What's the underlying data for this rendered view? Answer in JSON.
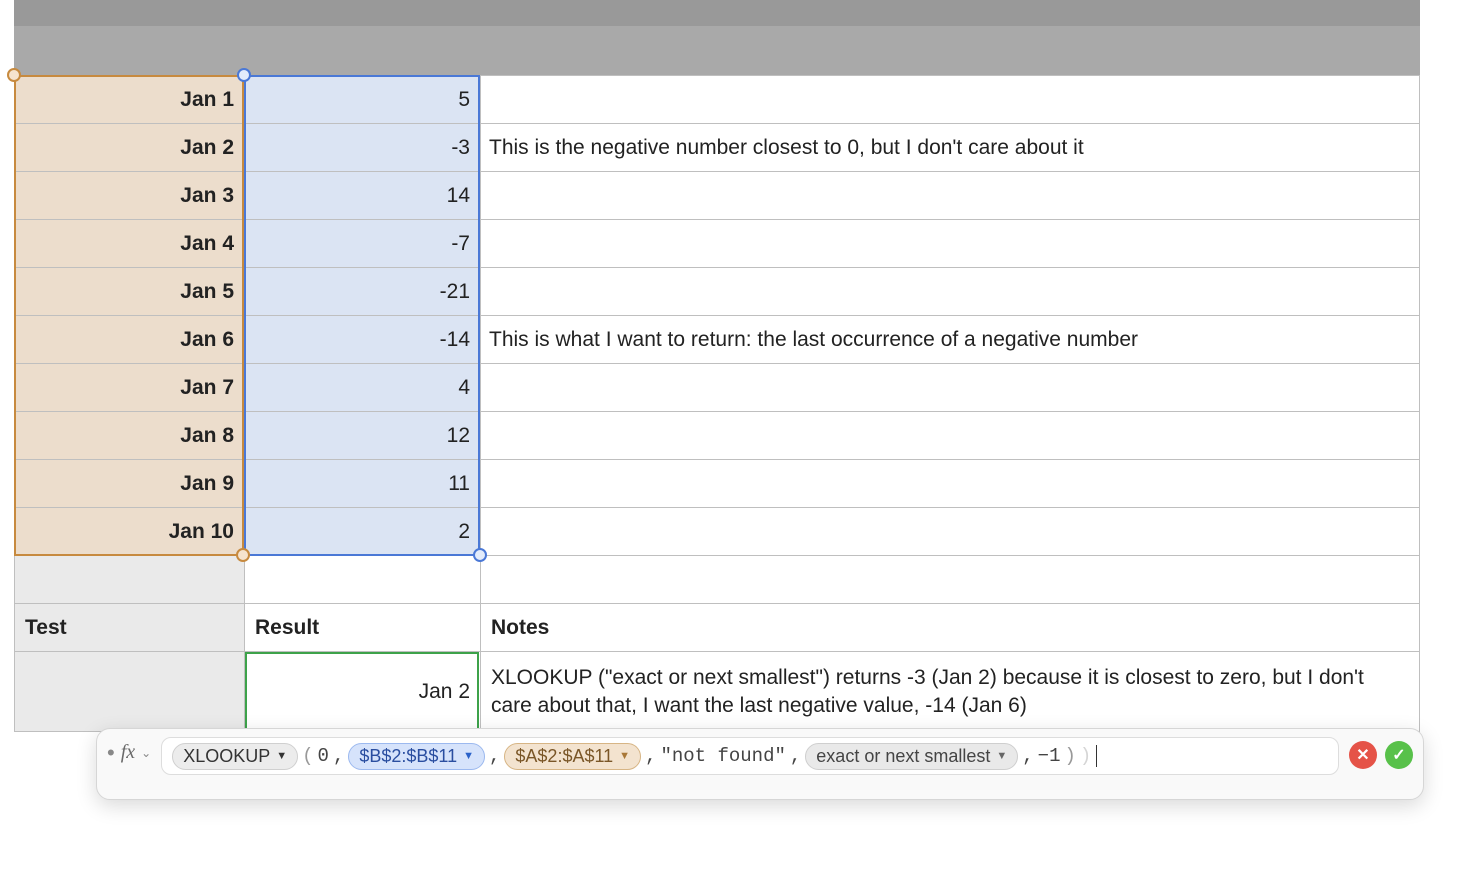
{
  "table": {
    "rows": [
      {
        "date": "Jan 1",
        "value": "5",
        "note": ""
      },
      {
        "date": "Jan 2",
        "value": "-3",
        "note": "This is the negative number closest to 0, but I don't care about it"
      },
      {
        "date": "Jan 3",
        "value": "14",
        "note": ""
      },
      {
        "date": "Jan 4",
        "value": "-7",
        "note": ""
      },
      {
        "date": "Jan 5",
        "value": "-21",
        "note": ""
      },
      {
        "date": "Jan 6",
        "value": "-14",
        "note": "This is what I want to return: the last occurrence of a negative number"
      },
      {
        "date": "Jan 7",
        "value": "4",
        "note": ""
      },
      {
        "date": "Jan 8",
        "value": "12",
        "note": ""
      },
      {
        "date": "Jan 9",
        "value": "11",
        "note": ""
      },
      {
        "date": "Jan 10",
        "value": "2",
        "note": ""
      }
    ],
    "headers": {
      "a": "Test",
      "b": "Result",
      "c": "Notes"
    },
    "result": {
      "value": "Jan 2",
      "note": "XLOOKUP (\"exact or next smallest\") returns -3 (Jan 2) because it is closest to zero, but I don't care about that, I want the last negative value, -14 (Jan 6)"
    }
  },
  "formula": {
    "fx_label": "fx",
    "function_name": "XLOOKUP",
    "arg1": "0",
    "range_b": "$B$2:$B$11",
    "range_a": "$A$2:$A$11",
    "not_found": "\"not found\"",
    "match_mode": "exact or next smallest",
    "search_mode": "−1",
    "comma": ",",
    "open": "(",
    "close": ")",
    "close2": ")"
  },
  "icons": {
    "cancel": "✕",
    "accept": "✓",
    "dropdown": "▼",
    "chevron": "⌄"
  }
}
